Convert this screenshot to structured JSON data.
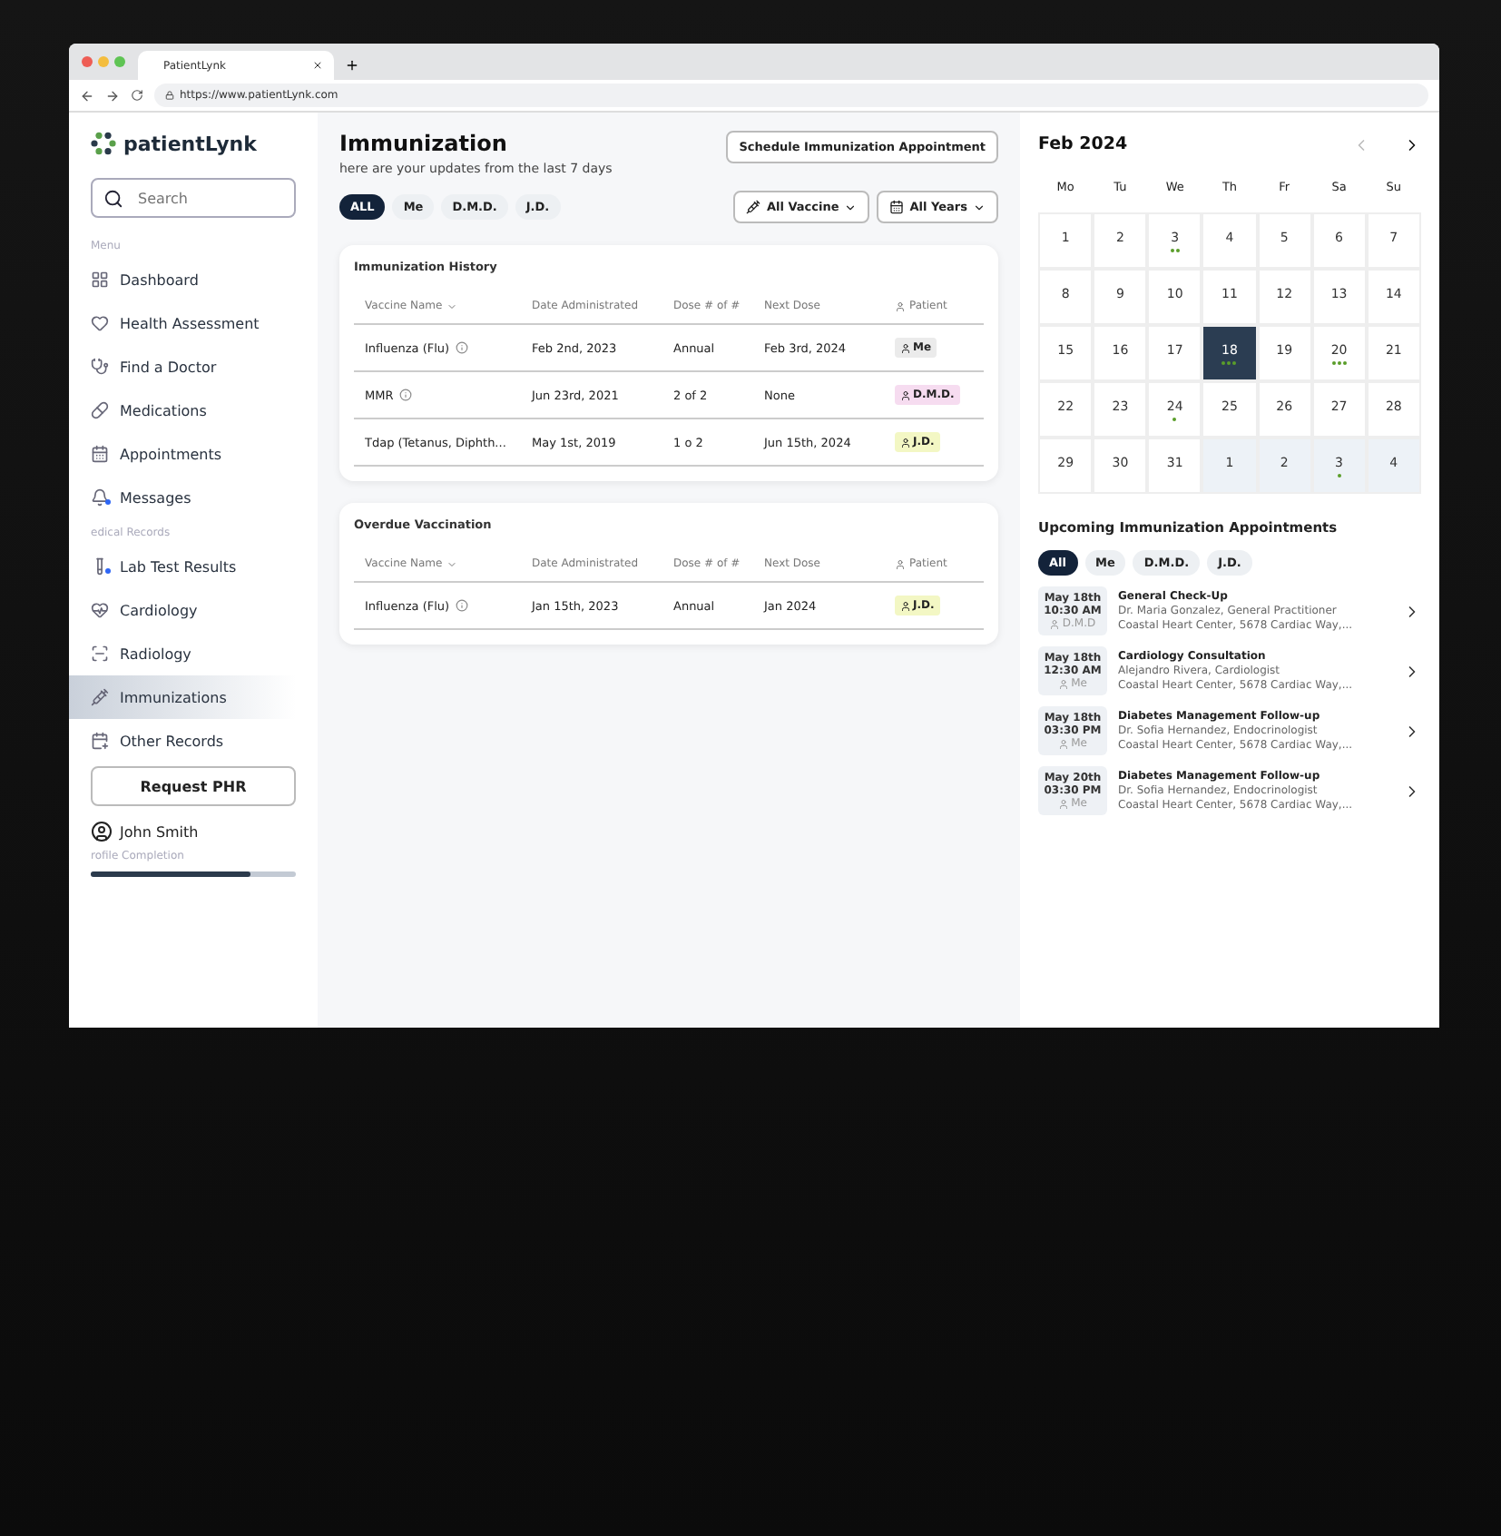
{
  "browser": {
    "tab_title": "PatientLynk",
    "url": "https://www.patientLynk.com"
  },
  "sidebar": {
    "logo": "patientLynk",
    "search_placeholder": "Search",
    "menu_label": "Menu",
    "menu_items": [
      {
        "label": "Dashboard",
        "selected": false,
        "badge": false
      },
      {
        "label": "Health Assessment",
        "selected": false,
        "badge": false
      },
      {
        "label": "Find a Doctor",
        "selected": false,
        "badge": false
      },
      {
        "label": "Medications",
        "selected": false,
        "badge": false
      },
      {
        "label": "Appointments",
        "selected": false,
        "badge": false
      },
      {
        "label": "Messages",
        "selected": false,
        "badge": true
      }
    ],
    "records_label": "edical Records",
    "record_items": [
      {
        "label": "Lab Test Results",
        "selected": false,
        "badge": true
      },
      {
        "label": "Cardiology",
        "selected": false,
        "badge": false
      },
      {
        "label": "Radiology",
        "selected": false,
        "badge": false
      },
      {
        "label": "Immunizations",
        "selected": true,
        "badge": false
      },
      {
        "label": "Other Records",
        "selected": false,
        "badge": false
      }
    ],
    "request_button": "Request PHR",
    "user_name": "John Smith",
    "profile": {
      "label": "rofile Completion",
      "level": 0.78
    }
  },
  "main": {
    "title": "Immunization",
    "subtitle": "here are your updates from the last 7 days",
    "action_button": "Schedule Immunization Appointment",
    "filters": [
      {
        "label": "ALL",
        "selected": true
      },
      {
        "label": "Me",
        "selected": false
      },
      {
        "label": "D.M.D.",
        "selected": false
      },
      {
        "label": "J.D.",
        "selected": false
      }
    ],
    "dropdowns": [
      "All Vaccine",
      "All Years"
    ],
    "tables": [
      {
        "title": "Immunization History",
        "columns": [
          "Vaccine Name",
          "Date Administrated",
          "Dose # of #",
          "Next Dose",
          "Patient"
        ],
        "rows": [
          {
            "vaccine": "Influenza (Flu)",
            "date": "Feb 2nd, 2023",
            "dose": "Annual",
            "next": "Feb 3rd, 2024",
            "patient": "Me",
            "color": "#ebebeb"
          },
          {
            "vaccine": "MMR",
            "date": "Jun 23rd, 2021",
            "dose": "2 of 2",
            "next": "None",
            "patient": "D.M.D.",
            "color": "#f6dcf0"
          },
          {
            "vaccine": "Tdap (Tetanus, Diphth...",
            "date": "May 1st, 2019",
            "dose": "1 o 2",
            "next": "Jun 15th, 2024",
            "patient": "J.D.",
            "color": "#f3f7c4"
          }
        ]
      },
      {
        "title": "Overdue Vaccination",
        "columns": [
          "Vaccine Name",
          "Date Administrated",
          "Dose # of #",
          "Next Dose",
          "Patient"
        ],
        "rows": [
          {
            "vaccine": "Influenza (Flu)",
            "date": "Jan 15th, 2023",
            "dose": "Annual",
            "next": "Jan 2024",
            "patient": "J.D.",
            "color": "#f3f7c4"
          }
        ]
      }
    ]
  },
  "calendar": {
    "month": "Feb 2024",
    "weekdays": [
      "Mo",
      "Tu",
      "We",
      "Th",
      "Fr",
      "Sa",
      "Su"
    ],
    "days": [
      {
        "day": "1",
        "selected": false,
        "kind": "current"
      },
      {
        "day": "2",
        "selected": false,
        "kind": "current"
      },
      {
        "day": "3",
        "selected": false,
        "kind": "current",
        "dots": [
          {
            "color": "#5a9e2a"
          },
          {
            "color": "#5a9e2a"
          }
        ]
      },
      {
        "day": "4",
        "selected": false,
        "kind": "current"
      },
      {
        "day": "5",
        "selected": false,
        "kind": "current"
      },
      {
        "day": "6",
        "selected": false,
        "kind": "current"
      },
      {
        "day": "7",
        "selected": false,
        "kind": "current"
      },
      {
        "day": "8",
        "selected": false,
        "kind": "current"
      },
      {
        "day": "9",
        "selected": false,
        "kind": "current"
      },
      {
        "day": "10",
        "selected": false,
        "kind": "current"
      },
      {
        "day": "11",
        "selected": false,
        "kind": "current"
      },
      {
        "day": "12",
        "selected": false,
        "kind": "current"
      },
      {
        "day": "13",
        "selected": false,
        "kind": "current"
      },
      {
        "day": "14",
        "selected": false,
        "kind": "current"
      },
      {
        "day": "15",
        "selected": false,
        "kind": "current"
      },
      {
        "day": "16",
        "selected": false,
        "kind": "current"
      },
      {
        "day": "17",
        "selected": false,
        "kind": "current"
      },
      {
        "day": "18",
        "selected": true,
        "kind": "current",
        "dots": [
          {
            "color": "#5a9e2a"
          },
          {
            "color": "#5a9e2a"
          },
          {
            "color": "#5a9e2a"
          }
        ]
      },
      {
        "day": "19",
        "selected": false,
        "kind": "current"
      },
      {
        "day": "20",
        "selected": false,
        "kind": "current",
        "dots": [
          {
            "color": "#5a9e2a"
          },
          {
            "color": "#5a9e2a"
          },
          {
            "color": "#5a9e2a"
          }
        ]
      },
      {
        "day": "21",
        "selected": false,
        "kind": "current"
      },
      {
        "day": "22",
        "selected": false,
        "kind": "current"
      },
      {
        "day": "23",
        "selected": false,
        "kind": "current"
      },
      {
        "day": "24",
        "selected": false,
        "kind": "current",
        "dots": [
          {
            "color": "#5a9e2a"
          }
        ]
      },
      {
        "day": "25",
        "selected": false,
        "kind": "current"
      },
      {
        "day": "26",
        "selected": false,
        "kind": "current"
      },
      {
        "day": "27",
        "selected": false,
        "kind": "current"
      },
      {
        "day": "28",
        "selected": false,
        "kind": "current"
      },
      {
        "day": "29",
        "selected": false,
        "kind": "current"
      },
      {
        "day": "30",
        "selected": false,
        "kind": "current"
      },
      {
        "day": "31",
        "selected": false,
        "kind": "current"
      },
      {
        "day": "1",
        "selected": false,
        "kind": "next"
      },
      {
        "day": "2",
        "selected": false,
        "kind": "next"
      },
      {
        "day": "3",
        "selected": false,
        "kind": "next",
        "dots": [
          {
            "color": "#5a9e2a"
          }
        ]
      },
      {
        "day": "4",
        "selected": false,
        "kind": "next"
      }
    ]
  },
  "upcoming": {
    "title": "Upcoming Immunization Appointments",
    "filters": [
      {
        "label": "All",
        "selected": true
      },
      {
        "label": "Me",
        "selected": false
      },
      {
        "label": "D.M.D.",
        "selected": false
      },
      {
        "label": "J.D.",
        "selected": false
      }
    ],
    "appointments": [
      {
        "date": "May 18th",
        "time": "10:30 AM",
        "patient": "D.M.D",
        "title": "General Check-Up",
        "doctor": "Dr. Maria Gonzalez, General Practitioner",
        "location": "Coastal Heart Center, 5678 Cardiac Way,..."
      },
      {
        "date": "May 18th",
        "time": "12:30 AM",
        "patient": "Me",
        "title": "Cardiology Consultation",
        "doctor": "Alejandro Rivera, Cardiologist",
        "location": "Coastal Heart Center, 5678 Cardiac Way,..."
      },
      {
        "date": "May 18th",
        "time": "03:30 PM",
        "patient": "Me",
        "title": "Diabetes Management Follow-up",
        "doctor": "Dr. Sofia Hernandez, Endocrinologist",
        "location": "Coastal Heart Center, 5678 Cardiac Way,..."
      },
      {
        "date": "May 20th",
        "time": "03:30 PM",
        "patient": "Me",
        "title": "Diabetes Management Follow-up",
        "doctor": "Dr. Sofia Hernandez, Endocrinologist",
        "location": "Coastal Heart Center, 5678 Cardiac Way,..."
      }
    ]
  }
}
